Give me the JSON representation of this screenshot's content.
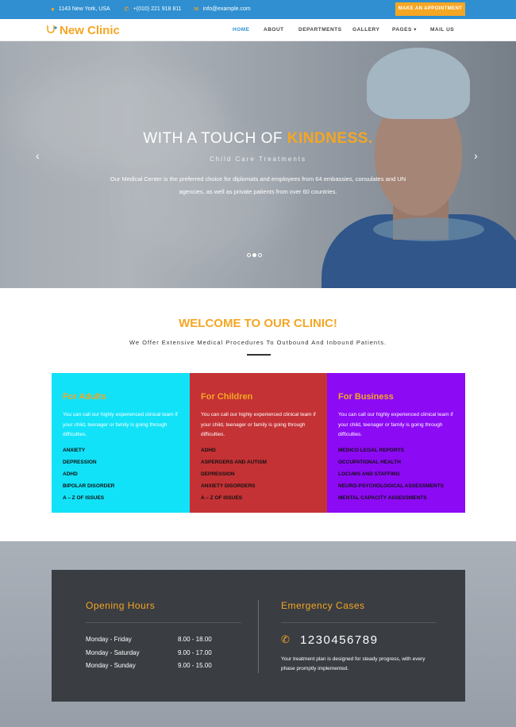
{
  "topbar": {
    "address": "1143 New York, USA",
    "phone": "+(010) 221 918 811",
    "email": "info@example.com",
    "cta_label": "MAKE AN APPOINTMENT",
    "icons": [
      "map-marker-icon",
      "phone-icon",
      "mail-icon"
    ],
    "accent_color": "#f5a623",
    "bar_color": "#2f8fd0"
  },
  "nav": {
    "logo_text": "New Clinic",
    "items": [
      "HOME",
      "ABOUT",
      "DEPARTMENTS",
      "GALLERY",
      "PAGES",
      "MAIL US"
    ],
    "active": "HOME"
  },
  "hero": {
    "title_main": "WITH A TOUCH OF ",
    "title_accent": "KINDNESS.",
    "subtitle": "Child Care Treatments",
    "description": "Our Medical Center is the preferred choice for diplomats and employees from 64 embassies, consulates and UN agencies, as well as private patients from over 60 countries.",
    "prev_arrow": "‹",
    "next_arrow": "›",
    "slide_count": 3,
    "active_slide": 2
  },
  "welcome": {
    "title": "WELCOME TO OUR CLINIC!",
    "subtitle": "We Offer Extensive Medical Procedures To Outbound And Inbound Patients."
  },
  "services": [
    {
      "title": "For Adults",
      "text": "You can call our highly experienced clinical team if your child, teenager or family is going through difficulties.",
      "items": [
        "ANXIETY",
        "DEPRESSION",
        "ADHD",
        "BIPOLAR DISORDER",
        "A – Z OF ISSUES"
      ],
      "color": "#12e2f8"
    },
    {
      "title": "For Children",
      "text": "You can call our highly experienced clinical team if your child, teenager or family is going through difficulties.",
      "items": [
        "ADHD",
        "ASPERGERS AND AUTISM",
        "DEPRESSION",
        "ANXIETY DISORDERS",
        "A – Z OF ISSUES"
      ],
      "color": "#c43235"
    },
    {
      "title": "For Business",
      "text": "You can call our highly experienced clinical team if your child, teenager or family is going through difficulties.",
      "items": [
        "MEDICO LEGAL REPORTS",
        "OCCUPATIONAL HEALTH",
        "LOCUMS AND STAFFING",
        "NEURO-PSYCHOLOGICAL ASSESSMENTS",
        "MENTAL CAPACITY ASSESSMENTS"
      ],
      "color": "#8d0af5"
    }
  ],
  "hours": {
    "title": "Opening Hours",
    "rows": [
      {
        "day": "Monday - Friday",
        "time": "8.00 - 18.00"
      },
      {
        "day": "Monday - Saturday",
        "time": "9.00 - 17.00"
      },
      {
        "day": "Monday - Sunday",
        "time": "9.00 - 15.00"
      }
    ]
  },
  "emergency": {
    "title": "Emergency Cases",
    "phone": "1230456789",
    "text": "Your treatment plan is designed for steady progress, with every phase promptly implemented."
  }
}
